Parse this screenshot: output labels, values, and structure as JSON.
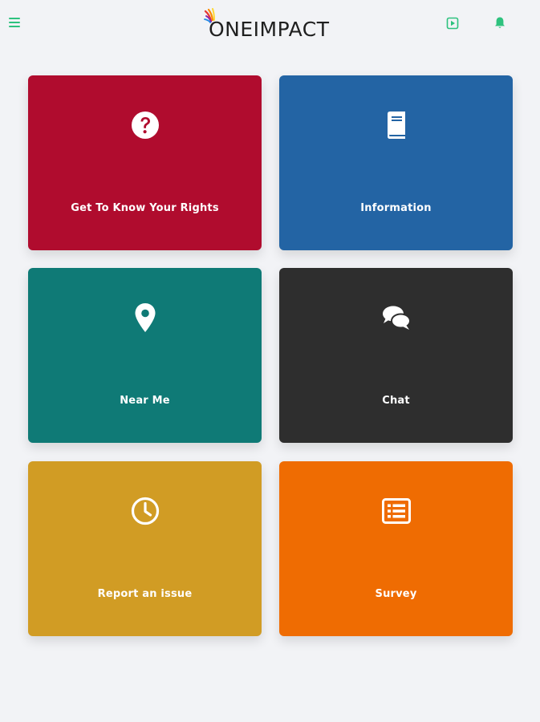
{
  "header": {
    "brand": "ONEIMPACT",
    "accent_color": "#2ec27e"
  },
  "tiles": [
    {
      "label": "Get To Know Your Rights",
      "icon": "question-circle-icon",
      "color": "#b00c2e"
    },
    {
      "label": "Information",
      "icon": "book-icon",
      "color": "#2364a4"
    },
    {
      "label": "Near Me",
      "icon": "map-pin-icon",
      "color": "#0f7a76"
    },
    {
      "label": "Chat",
      "icon": "chat-bubbles-icon",
      "color": "#2e2e2e"
    },
    {
      "label": "Report an issue",
      "icon": "clock-icon",
      "color": "#d19c24"
    },
    {
      "label": "Survey",
      "icon": "list-icon",
      "color": "#ef6c02"
    }
  ]
}
